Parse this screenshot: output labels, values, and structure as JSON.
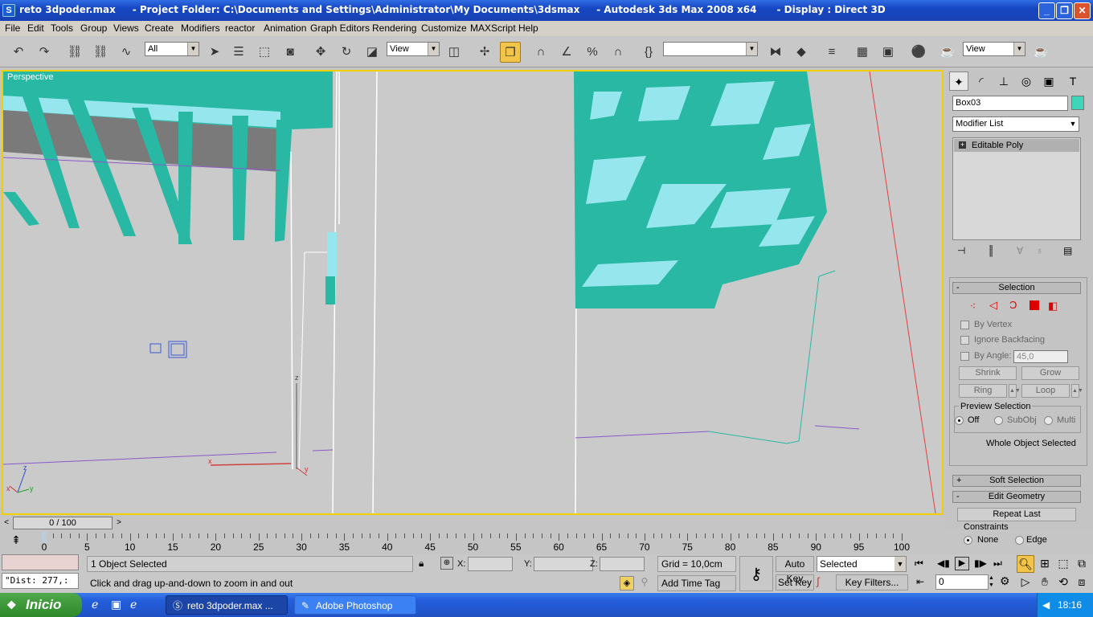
{
  "title": {
    "text": "reto 3dpoder.max     - Project Folder: C:\\Documents and Settings\\Administrator\\My Documents\\3dsmax     - Autodesk 3ds Max 2008 x64      - Display : Direct 3D"
  },
  "menu": [
    "File",
    "Edit",
    "Tools",
    "Group",
    "Views",
    "Create",
    "Modifiers",
    "reactor",
    "Animation",
    "Graph Editors",
    "Rendering",
    "Customize",
    "MAXScript",
    "Help"
  ],
  "toolbar": {
    "filter_value": "All",
    "refcoord_value": "View",
    "named_selection_value": "",
    "render_view_value": "View"
  },
  "viewport": {
    "label": "Perspective"
  },
  "command_panel": {
    "object_name": "Box03",
    "object_color": "#3fd5b8",
    "modifier_list_label": "Modifier List",
    "stack_item": "Editable Poly",
    "selection": {
      "title": "Selection",
      "by_vertex": "By Vertex",
      "ignore_backfacing": "Ignore Backfacing",
      "by_angle": "By Angle:",
      "angle_value": "45,0",
      "shrink": "Shrink",
      "grow": "Grow",
      "ring": "Ring",
      "loop": "Loop",
      "preview_title": "Preview Selection",
      "off": "Off",
      "subobj": "SubObj",
      "multi": "Multi",
      "status": "Whole Object Selected"
    },
    "soft_selection": "Soft Selection",
    "edit_geometry": {
      "title": "Edit Geometry",
      "repeat_last": "Repeat Last",
      "constraints": "Constraints",
      "none": "None",
      "edge": "Edge"
    }
  },
  "timeline": {
    "frame_display": "0 / 100",
    "ticks": [
      "0",
      "5",
      "10",
      "15",
      "20",
      "25",
      "30",
      "35",
      "40",
      "45",
      "50",
      "55",
      "60",
      "65",
      "70",
      "75",
      "80",
      "85",
      "90",
      "95",
      "100"
    ]
  },
  "status": {
    "script_line": "\"Dist: 277,:",
    "selected": "1 Object Selected",
    "prompt": "Click and drag up-and-down to zoom in and out",
    "x_label": "X:",
    "y_label": "Y:",
    "z_label": "Z:",
    "grid": "Grid = 10,0cm",
    "add_time_tag": "Add Time Tag",
    "auto_key": "Auto Key",
    "set_key": "Set Key",
    "selected_dropdown": "Selected",
    "key_filters": "Key Filters...",
    "frame_value": "0"
  },
  "taskbar": {
    "start": "Inicio",
    "tasks": [
      "reto 3dpoder.max     ...",
      "Adobe Photoshop"
    ],
    "clock": "18:16"
  }
}
